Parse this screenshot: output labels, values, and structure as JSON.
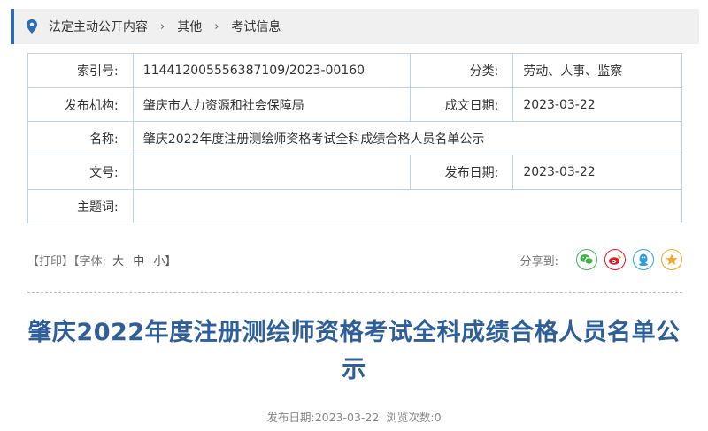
{
  "breadcrumb": {
    "items": [
      "法定主动公开内容",
      "其他",
      "考试信息"
    ],
    "separator": "›"
  },
  "meta": {
    "index_label": "索引号:",
    "index_value": "114412005556387109/2023-00160",
    "category_label": "分类:",
    "category_value": "劳动、人事、监察",
    "publisher_label": "发布机构:",
    "publisher_value": "肇庆市人力资源和社会保障局",
    "created_label": "成文日期:",
    "created_value": "2023-03-22",
    "name_label": "名称:",
    "name_value": "肇庆2022年度注册测绘师资格考试全科成绩合格人员名单公示",
    "docno_label": "文号:",
    "docno_value": "",
    "published_label": "发布日期:",
    "published_value": "2023-03-22",
    "keywords_label": "主题词:",
    "keywords_value": ""
  },
  "tools": {
    "print": "【打印】",
    "font_prefix": "【字体:",
    "font_large": "大",
    "font_medium": "中",
    "font_small": "小】",
    "share_label": "分享到:",
    "share_icons": [
      "wechat-icon",
      "weibo-icon",
      "qq-icon",
      "qzone-icon"
    ]
  },
  "article": {
    "title": "肇庆2022年度注册测绘师资格考试全科成绩合格人员名单公示",
    "date_label": "发布日期:",
    "date_value": "2023-03-22",
    "views_label": "浏览次数:",
    "views_value": "0"
  },
  "colors": {
    "accent": "#2d6cb0",
    "title": "#2e5f9b",
    "table_border": "#b9d3ea",
    "wechat": "#3fb24f",
    "weibo": "#e6162d",
    "qq": "#2d9ee0",
    "qzone": "#f5a623"
  }
}
